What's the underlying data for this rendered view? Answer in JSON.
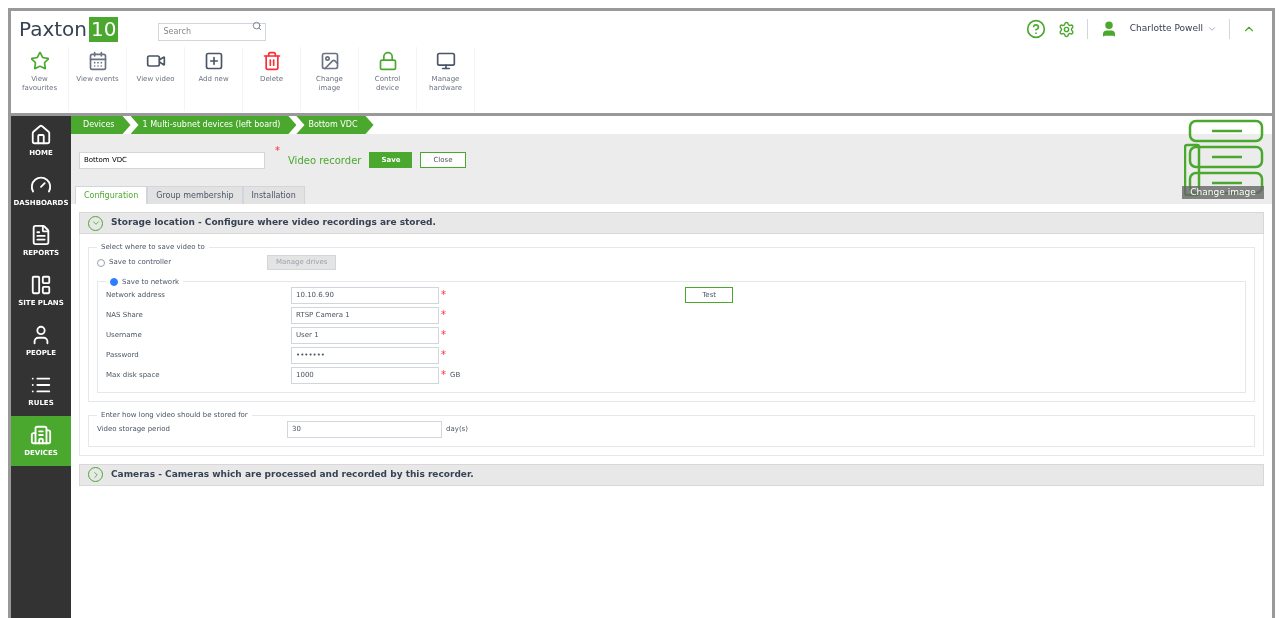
{
  "brand": {
    "name": "Paxton",
    "badge": "10"
  },
  "search": {
    "placeholder": "Search"
  },
  "user": {
    "name": "Charlotte Powell"
  },
  "toolbar": [
    {
      "label": "View favourites"
    },
    {
      "label": "View events"
    },
    {
      "label": "View video"
    },
    {
      "label": "Add new"
    },
    {
      "label": "Delete"
    },
    {
      "label": "Change image"
    },
    {
      "label": "Control device"
    },
    {
      "label": "Manage hardware"
    }
  ],
  "sidebar": {
    "items": [
      {
        "label": "HOME",
        "selected": false
      },
      {
        "label": "DASHBOARDS",
        "selected": false
      },
      {
        "label": "REPORTS",
        "selected": false
      },
      {
        "label": "SITE PLANS",
        "selected": false
      },
      {
        "label": "PEOPLE",
        "selected": false
      },
      {
        "label": "RULES",
        "selected": false
      },
      {
        "label": "DEVICES",
        "selected": true
      }
    ]
  },
  "breadcrumbs": [
    "Devices",
    "1 Multi-subnet devices (left board)",
    "Bottom VDC"
  ],
  "required_mark": "*",
  "device": {
    "name": "Bottom VDC",
    "type": "Video recorder",
    "buttons": [
      {
        "label": "Save",
        "kind": "primary"
      },
      {
        "label": "Close",
        "kind": "secondary"
      }
    ],
    "change_image": "Change image"
  },
  "tabs": [
    {
      "label": "Configuration",
      "selected": true
    },
    {
      "label": "Group membership",
      "selected": false
    },
    {
      "label": "Installation",
      "selected": false
    }
  ],
  "storage": {
    "title": "Storage location - Configure where video recordings are stored.",
    "expanded": true,
    "legend": "Select where to save video to",
    "options": [
      {
        "label": "Save to controller",
        "selected": false
      },
      {
        "label": "Save to network",
        "selected": true
      }
    ],
    "manage_drives": {
      "label": "Manage drives",
      "disabled": true
    },
    "test_button": "Test",
    "fields": [
      {
        "label": "Network address",
        "value": "10.10.6.90",
        "required": true
      },
      {
        "label": "NAS Share",
        "value": "RTSP Camera 1",
        "required": true
      },
      {
        "label": "Username",
        "value": "User 1",
        "required": true
      },
      {
        "label": "Password",
        "value": "•••••••",
        "required": true
      },
      {
        "label": "Max disk space",
        "value": "1000",
        "required": true,
        "unit": "GB"
      }
    ],
    "retention": {
      "legend": "Enter how long video should be stored for",
      "label": "Video storage period",
      "value": "30",
      "unit": "day(s)"
    }
  },
  "cameras": {
    "title": "Cameras - Cameras which are processed and recorded by this recorder.",
    "expanded": false
  }
}
